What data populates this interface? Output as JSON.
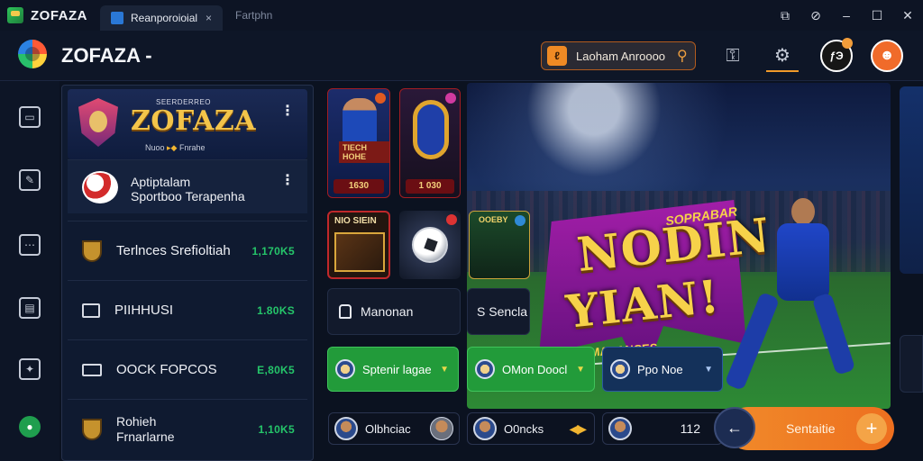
{
  "window": {
    "app_name": "ZOFAZA",
    "tabs": [
      {
        "title": "Reanporoioial",
        "close": "×"
      },
      {
        "title": "Fartphn"
      }
    ],
    "controls": [
      "⧉",
      "⊘",
      "–",
      "☐",
      "✕"
    ]
  },
  "header": {
    "brand": "ZOFAZA -",
    "search": {
      "badge": "ℓ",
      "value": "Laoham Anroooo",
      "icon": "search-icon"
    },
    "avatar_badge": "ƒЭ"
  },
  "rail": {
    "icons": [
      "bag-icon",
      "edit-icon",
      "chat-icon",
      "store-icon",
      "compass-icon",
      "profile-icon"
    ]
  },
  "panel": {
    "hero": {
      "eyebrow": "SEERDERREO",
      "title": "ZOFAZA",
      "sub_left": "Nuoo",
      "sub_right": "Fnrahe"
    },
    "featured": {
      "line1": "Aptiptalam",
      "line2": "Sportboo Terapenha"
    },
    "menu": [
      {
        "label": "Terlnces Srefioltiah",
        "value": "1,170K5"
      },
      {
        "label": "PIIHHUSI",
        "value": "1.80KS"
      },
      {
        "label": "OOCK FOPCOS",
        "value": "E,80K5"
      },
      {
        "label_line1": "Rohieh",
        "label_line2": "Frnarlarne",
        "value": "1,10K5"
      }
    ]
  },
  "cards": {
    "player1_tag": "1630",
    "player1_banner": "TIECH HOHE",
    "player2_tag": "1 030",
    "s1_title": "NIO SIEIN",
    "s3_title": "OOEBY"
  },
  "wide_cards": [
    {
      "label": "Manonan"
    },
    {
      "label": "S Sencla"
    }
  ],
  "banner": {
    "top_tag": "SOPRABAR",
    "word1": "NODIN",
    "word2": "YIAN!",
    "subtitle": "FINIMARANCES"
  },
  "selects": [
    {
      "label": "Sptenir lagae"
    },
    {
      "label": "OMon Doocl"
    },
    {
      "label": "Ppo Noe"
    }
  ],
  "chips": [
    {
      "label": "Olbhciac"
    },
    {
      "label": "O0ncks"
    },
    {
      "label": "",
      "number": "112"
    }
  ],
  "cta": {
    "label": "Sentaitie",
    "plus": "+",
    "back": "←"
  },
  "colors": {
    "accent": "#f08a2a",
    "green": "#229b3a",
    "bg": "#0b1220"
  }
}
